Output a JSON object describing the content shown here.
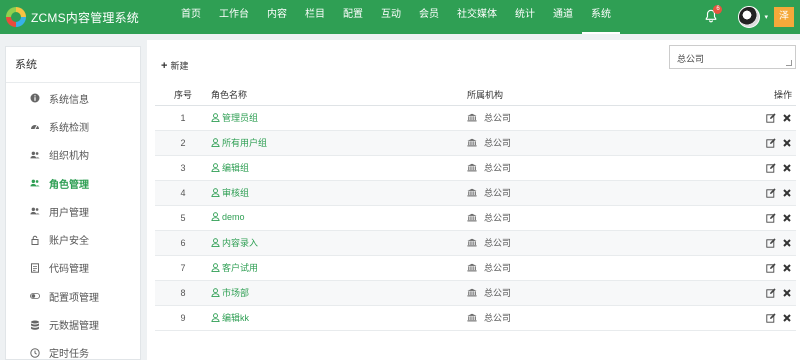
{
  "app": {
    "brand": "ZCMS内容管理系统",
    "notification_count": "6",
    "user_initial": "泽"
  },
  "nav": [
    {
      "label": "首页"
    },
    {
      "label": "工作台"
    },
    {
      "label": "内容"
    },
    {
      "label": "栏目"
    },
    {
      "label": "配置"
    },
    {
      "label": "互动"
    },
    {
      "label": "会员"
    },
    {
      "label": "社交媒体"
    },
    {
      "label": "统计"
    },
    {
      "label": "通道"
    },
    {
      "label": "系统",
      "active": true
    }
  ],
  "sidebar": {
    "title": "系统",
    "items": [
      {
        "label": "系统信息",
        "icon": "info-icon"
      },
      {
        "label": "系统检测",
        "icon": "dashboard-icon"
      },
      {
        "label": "组织机构",
        "icon": "users-icon"
      },
      {
        "label": "角色管理",
        "icon": "users-icon",
        "active": true
      },
      {
        "label": "用户管理",
        "icon": "users-icon"
      },
      {
        "label": "账户安全",
        "icon": "lock-icon"
      },
      {
        "label": "代码管理",
        "icon": "code-icon"
      },
      {
        "label": "配置项管理",
        "icon": "toggle-icon"
      },
      {
        "label": "元数据管理",
        "icon": "database-icon"
      },
      {
        "label": "定时任务",
        "icon": "clock-icon"
      }
    ]
  },
  "toolbar": {
    "add_label": "新建",
    "org_filter": "总公司"
  },
  "table": {
    "headers": {
      "no": "序号",
      "name": "角色名称",
      "org": "所属机构",
      "op": "操作"
    },
    "rows": [
      {
        "no": "1",
        "name": "管理员组",
        "org": "总公司"
      },
      {
        "no": "2",
        "name": "所有用户组",
        "org": "总公司"
      },
      {
        "no": "3",
        "name": "编辑组",
        "org": "总公司"
      },
      {
        "no": "4",
        "name": "审核组",
        "org": "总公司"
      },
      {
        "no": "5",
        "name": "demo",
        "org": "总公司"
      },
      {
        "no": "6",
        "name": "内容录入",
        "org": "总公司"
      },
      {
        "no": "7",
        "name": "客户试用",
        "org": "总公司"
      },
      {
        "no": "8",
        "name": "市场部",
        "org": "总公司"
      },
      {
        "no": "9",
        "name": "编辑kk",
        "org": "总公司"
      }
    ]
  },
  "colors": {
    "brand_green": "#2f9f54",
    "badge_red": "#e8543f",
    "user_chip": "#f4a93a"
  }
}
